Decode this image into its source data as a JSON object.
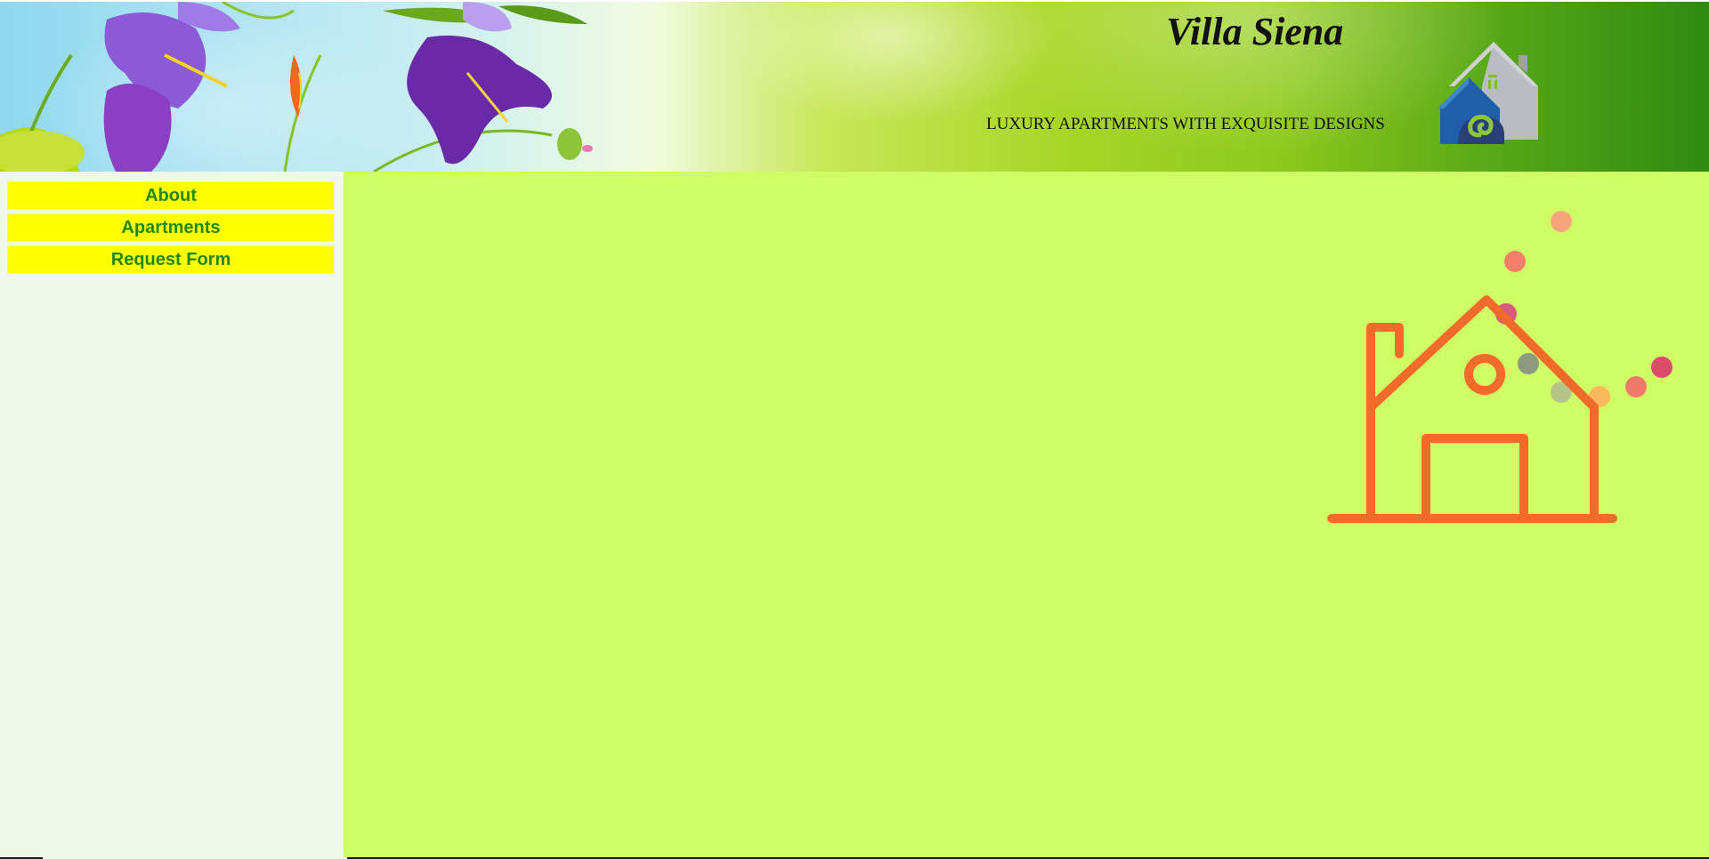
{
  "header": {
    "title": "Villa Siena",
    "tagline": "LUXURY APARTMENTS WITH EXQUISITE DESIGNS",
    "logo_icon": "house-spiral-logo"
  },
  "sidebar": {
    "items": [
      {
        "label": "About"
      },
      {
        "label": "Apartments"
      },
      {
        "label": "Request Form"
      }
    ]
  },
  "colors": {
    "nav_background": "#ffff00",
    "nav_text": "#1f8a14",
    "main_background": "#cffd65",
    "sidebar_background": "#eef8e8",
    "house_stroke": "#f26b2a"
  },
  "main": {
    "illustration_icon": "animated-house-icon"
  }
}
